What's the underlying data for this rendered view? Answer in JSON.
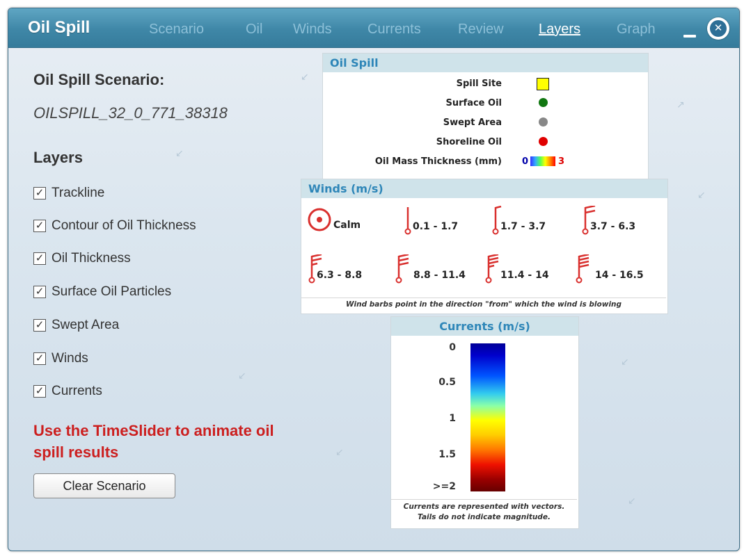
{
  "window": {
    "title": "Oil Spill"
  },
  "tabs": [
    {
      "label": "Scenario"
    },
    {
      "label": "Oil"
    },
    {
      "label": "Winds"
    },
    {
      "label": "Currents"
    },
    {
      "label": "Review"
    },
    {
      "label": "Layers",
      "active": true
    },
    {
      "label": "Graph"
    }
  ],
  "left": {
    "scenario_heading": "Oil Spill Scenario:",
    "scenario_name": "OILSPILL_32_0_771_38318",
    "layers_heading": "Layers",
    "layers": [
      {
        "label": "Trackline",
        "checked": true
      },
      {
        "label": "Contour of Oil Thickness",
        "checked": true
      },
      {
        "label": "Oil Thickness",
        "checked": true
      },
      {
        "label": "Surface Oil Particles",
        "checked": true
      },
      {
        "label": "Swept Area",
        "checked": true
      },
      {
        "label": "Winds",
        "checked": true
      },
      {
        "label": "Currents",
        "checked": true
      }
    ],
    "note": "Use the TimeSlider to animate oil spill results",
    "clear_button": "Clear Scenario"
  },
  "oil_legend": {
    "header": "Oil Spill",
    "items": [
      {
        "label": "Spill Site",
        "symbol": "yellow-square"
      },
      {
        "label": "Surface Oil",
        "symbol": "green-dot"
      },
      {
        "label": "Swept Area",
        "symbol": "gray-dot"
      },
      {
        "label": "Shoreline Oil",
        "symbol": "red-dot"
      }
    ],
    "thickness_label": "Oil Mass Thickness (mm)",
    "thickness_min": "0",
    "thickness_max": "3"
  },
  "winds_legend": {
    "header": "Winds (m/s)",
    "items": [
      "Calm",
      "0.1 - 1.7",
      "1.7 - 3.7",
      "3.7 - 6.3",
      "6.3 - 8.8",
      "8.8 - 11.4",
      "11.4 - 14",
      "14 - 16.5"
    ],
    "note": "Wind barbs point in the direction \"from\" which the wind is blowing"
  },
  "currents_legend": {
    "header": "Currents (m/s)",
    "ticks": [
      "0",
      "0.5",
      "1",
      "1.5",
      ">=2"
    ],
    "note_line1": "Currents are represented with vectors.",
    "note_line2": "Tails do not indicate magnitude."
  },
  "colors": {
    "titlebar": "#3f87a7",
    "tab_inactive": "#8dc0d8",
    "tab_active": "#ffffff",
    "panel_header": "#cfe3ea",
    "panel_header_text": "#2e86b8",
    "note_red": "#cc1f1f",
    "wind_barb": "#d9302e",
    "spill_site": "#ffff00",
    "surface_oil": "#117711",
    "swept_area": "#888888",
    "shoreline_oil": "#e00000"
  }
}
